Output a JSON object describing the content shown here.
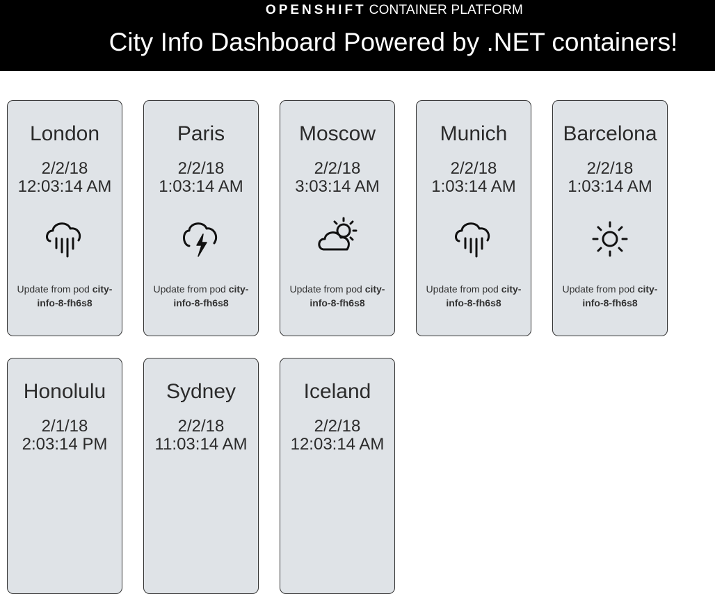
{
  "header": {
    "brand_strong": "OPENSHIFT",
    "brand_light": "CONTAINER PLATFORM",
    "title": "City Info Dashboard Powered by .NET containers!"
  },
  "cards": [
    {
      "city": "London",
      "date": "2/2/18",
      "time": "12:03:14 AM",
      "icon": "rain-icon",
      "pod_prefix": "Update from pod",
      "pod_name": "city-info-8-fh6s8"
    },
    {
      "city": "Paris",
      "date": "2/2/18",
      "time": "1:03:14 AM",
      "icon": "thunderstorm-icon",
      "pod_prefix": "Update from pod",
      "pod_name": "city-info-8-fh6s8"
    },
    {
      "city": "Moscow",
      "date": "2/2/18",
      "time": "3:03:14 AM",
      "icon": "partly-cloudy-icon",
      "pod_prefix": "Update from pod",
      "pod_name": "city-info-8-fh6s8"
    },
    {
      "city": "Munich",
      "date": "2/2/18",
      "time": "1:03:14 AM",
      "icon": "rain-icon",
      "pod_prefix": "Update from pod",
      "pod_name": "city-info-8-fh6s8"
    },
    {
      "city": "Barcelona",
      "date": "2/2/18",
      "time": "1:03:14 AM",
      "icon": "sun-icon",
      "pod_prefix": "Update from pod",
      "pod_name": "city-info-8-fh6s8"
    },
    {
      "city": "Honolulu",
      "date": "2/1/18",
      "time": "2:03:14 PM",
      "icon": "",
      "pod_prefix": "",
      "pod_name": ""
    },
    {
      "city": "Sydney",
      "date": "2/2/18",
      "time": "11:03:14 AM",
      "icon": "",
      "pod_prefix": "",
      "pod_name": ""
    },
    {
      "city": "Iceland",
      "date": "2/2/18",
      "time": "12:03:14 AM",
      "icon": "",
      "pod_prefix": "",
      "pod_name": ""
    }
  ]
}
